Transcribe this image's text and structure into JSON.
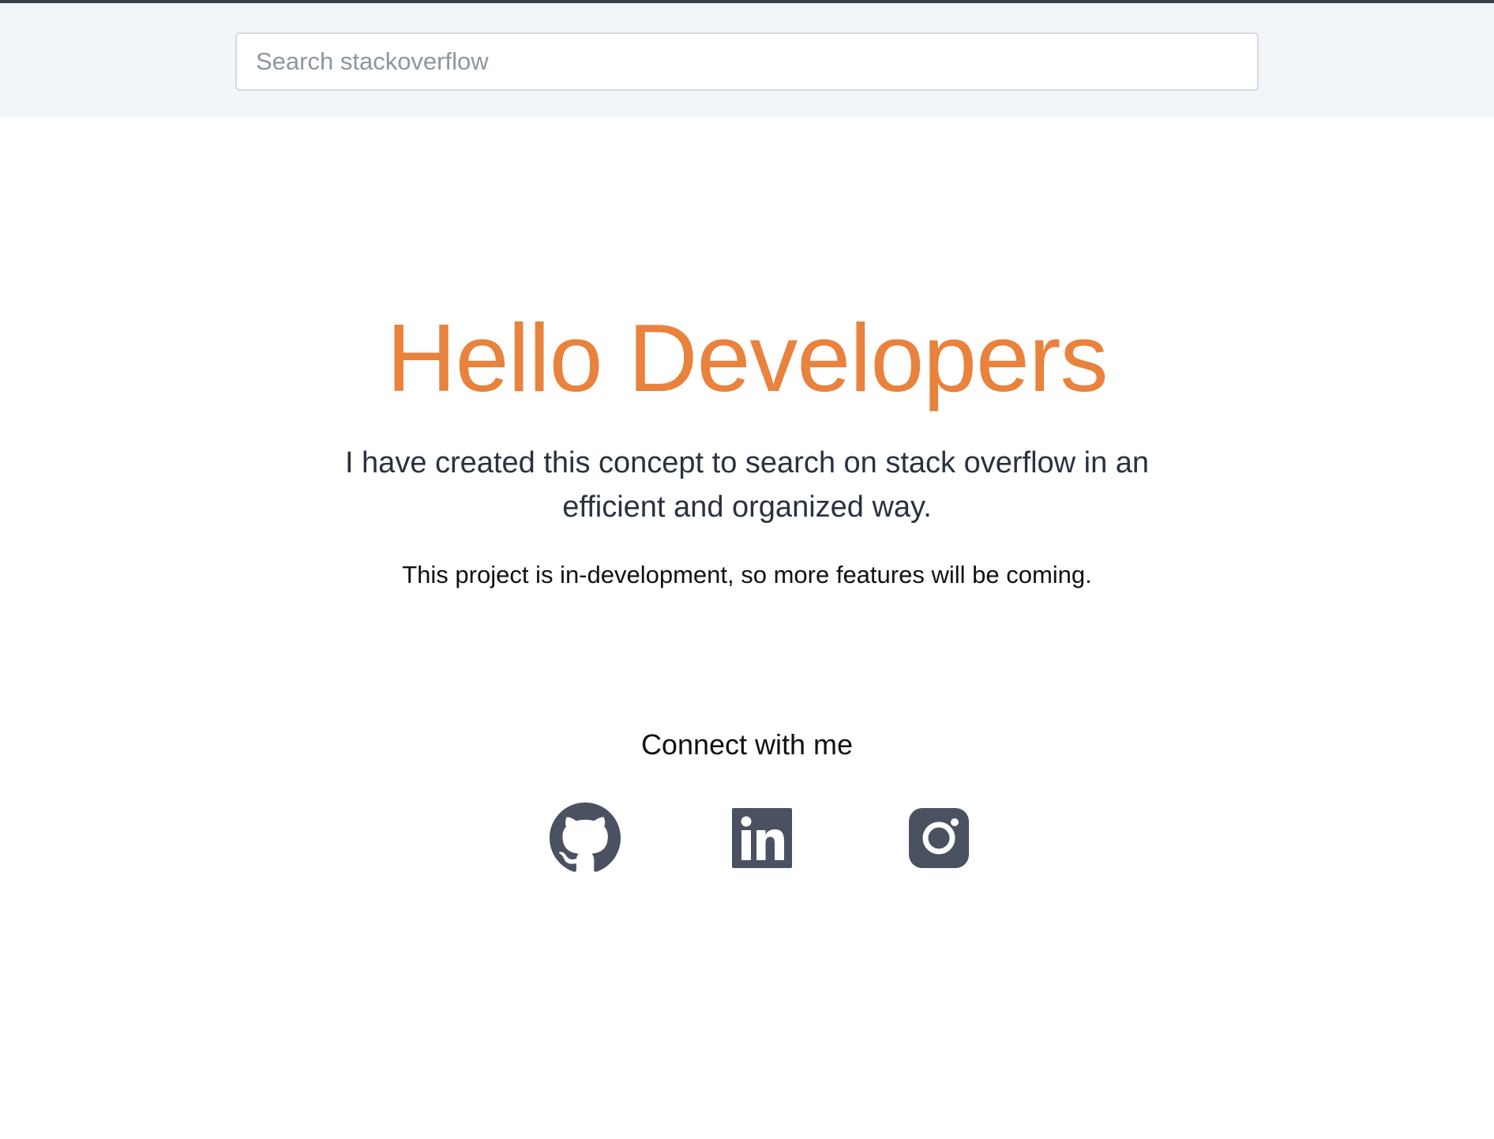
{
  "search": {
    "placeholder": "Search stackoverflow",
    "value": ""
  },
  "hero": {
    "title": "Hello Developers",
    "subtitle": "I have created this concept to search on stack overflow in an efficient and organized way.",
    "note": "This project is in-development, so more features will be coming."
  },
  "connect": {
    "title": "Connect with me",
    "links": [
      {
        "icon": "github-icon"
      },
      {
        "icon": "linkedin-icon"
      },
      {
        "icon": "instagram-icon"
      }
    ]
  },
  "colors": {
    "accent": "#e8823c",
    "icon": "#4a5160",
    "header_bg": "#f2f5f9"
  }
}
